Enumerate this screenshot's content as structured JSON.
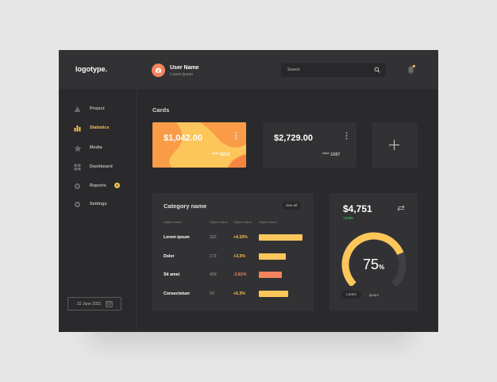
{
  "header": {
    "logo": "logotype.",
    "user_name": "User Name",
    "user_subtitle": "Lorem ipsum",
    "search_placeholder": "Search"
  },
  "sidebar": {
    "items": [
      {
        "label": "Project",
        "icon": "triangle-icon",
        "active": false
      },
      {
        "label": "Statistics",
        "icon": "bar-chart-icon",
        "active": true
      },
      {
        "label": "Media",
        "icon": "star-icon",
        "active": false
      },
      {
        "label": "Dashboard",
        "icon": "grid-icon",
        "active": false
      },
      {
        "label": "Reports",
        "icon": "gear-icon",
        "active": false,
        "badge": "2"
      },
      {
        "label": "Settings",
        "icon": "gear-icon",
        "active": false
      }
    ],
    "date": "22 June 2021"
  },
  "cards": {
    "title": "Cards",
    "items": [
      {
        "amount": "$1,042.00",
        "number": "**** 0213"
      },
      {
        "amount": "$2,729.00",
        "number": "**** 1587"
      }
    ]
  },
  "category": {
    "title": "Category name",
    "see_all": "See all",
    "headers": [
      "Object name",
      "Object name",
      "Object name",
      "Object name"
    ],
    "rows": [
      {
        "name": "Lorem ipsum",
        "value": "322",
        "change": "+4.33%",
        "level": 1.0
      },
      {
        "name": "Dolor",
        "value": "173",
        "change": "+3.3%",
        "level": 0.61
      },
      {
        "name": "Sit amet",
        "value": "458",
        "change": "-2.81%",
        "level": 0.52
      },
      {
        "name": "Consectetuer",
        "value": "93",
        "change": "+5.3%",
        "level": 0.67
      }
    ]
  },
  "summary": {
    "amount": "$4,751",
    "change": "+3.5%",
    "percent": "75",
    "percent_sign": "%",
    "gauge_value": 0.75,
    "legend_a": "Lorem",
    "legend_b": "ipsum"
  },
  "colors": {
    "accent": "#f6c453",
    "orange": "#f4845c",
    "positive": "#3fbf6e",
    "panel": "#323234"
  }
}
